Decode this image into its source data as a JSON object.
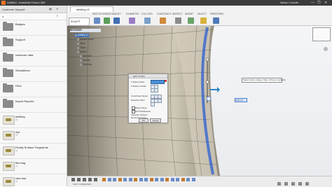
{
  "window": {
    "title": "Untitled - Autodesk Fusion 360",
    "user": "Nathan Chandler",
    "controls": [
      "—",
      "❐",
      "✕"
    ]
  },
  "left_panel": {
    "project": "Customer Support",
    "items": [
      {
        "label": "Badges",
        "kind": "folder"
      },
      {
        "label": "Support",
        "kind": "folder"
      },
      {
        "label": "customer data",
        "kind": "folder"
      },
      {
        "label": "Simulations",
        "kind": "folder"
      },
      {
        "label": "Files",
        "kind": "folder"
      },
      {
        "label": "Import Reports",
        "kind": "folder"
      },
      {
        "label": "shelling",
        "kind": "model",
        "sub": "v1"
      },
      {
        "label": "Apt",
        "kind": "model",
        "sub": "v1"
      },
      {
        "label": "Finally Surface Fragments",
        "kind": "model",
        "sub": "v1"
      },
      {
        "label": "film bag",
        "kind": "model",
        "sub": "v1"
      },
      {
        "label": "cars test",
        "kind": "model",
        "sub": "v1"
      }
    ]
  },
  "toolbar": {
    "doc_tab": "shelling v1",
    "tabs": [
      "SKETCH",
      "CREATE",
      "MODIFY",
      "SYMMETRY",
      "UTILITIES",
      "CONSTRUCT",
      "INSPECT",
      "INSERT",
      "SELECT",
      "FREEFORM"
    ],
    "mode": "SCULPT"
  },
  "browser": {
    "title": "BROWSER",
    "rows": [
      "shelling v1",
      "Named Views",
      "Units",
      "Origin",
      "Bodies",
      "Sketches",
      "Models",
      "Sketches"
    ]
  },
  "edit_form": {
    "title": "EDIT FORM",
    "t_spline_entity": "T-Spline Entity",
    "transform_mode": "Transform Mode",
    "coordinate_space": "Coordinate Space",
    "selection_filter": "Selection Filter",
    "object_snap": "Object Snap",
    "soft_modification": "Soft Modification",
    "selection_options": "Selection Options",
    "numerical_inputs": "Numerical Inputs",
    "ok": "OK",
    "cancel": "Cancel"
  },
  "tooltip": "Select vertex, edge or face. Alt key to extrude",
  "value_input": "0.00 mm",
  "timeline": {
    "label": "TEXT COMMANDS"
  }
}
